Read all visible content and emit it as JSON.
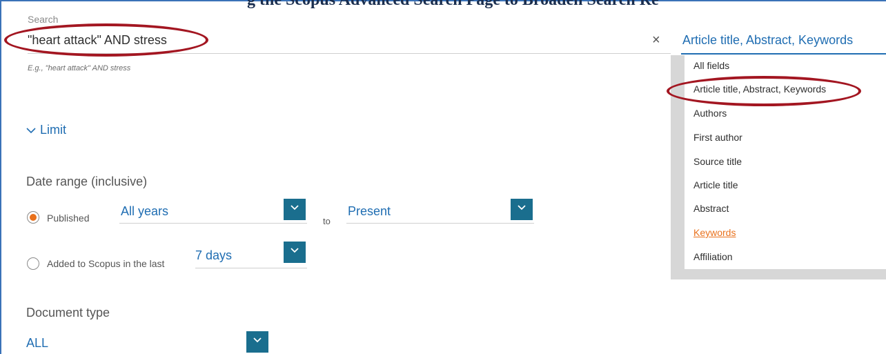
{
  "colors": {
    "accent": "#1f6db2",
    "highlight": "#e9711c",
    "dropdown_button": "#1a6e8e",
    "annotation": "#a31621"
  },
  "top_title_partial": "g the Scopus Advanced Search Page to Broaden Search Re",
  "search": {
    "label": "Search",
    "value": "\"heart attack\" AND stress",
    "example": "E.g., \"heart attack\" AND stress",
    "clear_icon": "close-icon"
  },
  "field_select": {
    "selected": "Article title, Abstract, Keywords",
    "options": [
      "All fields",
      "Article title, Abstract, Keywords",
      "Authors",
      "First author",
      "Source title",
      "Article title",
      "Abstract",
      "Keywords",
      "Affiliation"
    ],
    "hovered_option": "Keywords"
  },
  "limit": {
    "label": "Limit",
    "icon": "chevron-down-icon"
  },
  "date_range": {
    "title": "Date range (inclusive)",
    "published_label": "Published",
    "from": "All years",
    "to_label": "to",
    "to": "Present",
    "added_label": "Added to Scopus in the last",
    "added_value": "7 days"
  },
  "document_type": {
    "title": "Document type",
    "value": "ALL"
  }
}
